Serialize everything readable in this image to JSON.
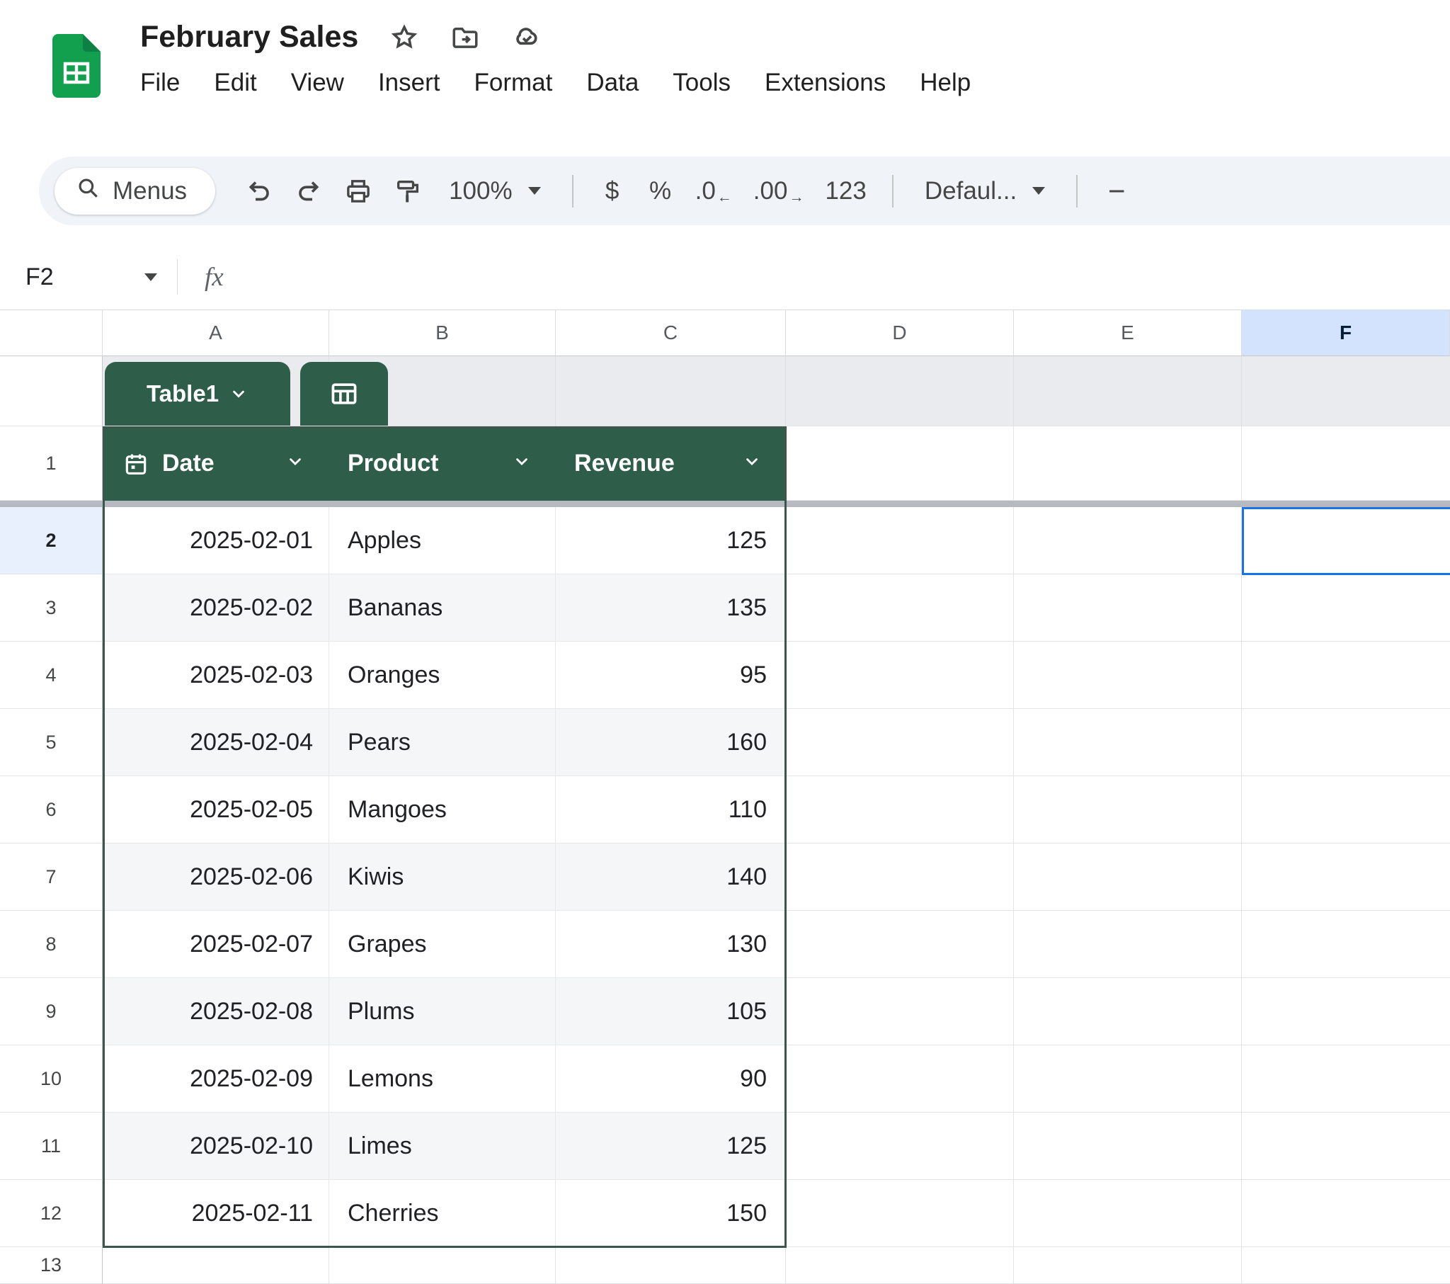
{
  "doc": {
    "title": "February Sales"
  },
  "menu": {
    "items": [
      "File",
      "Edit",
      "View",
      "Insert",
      "Format",
      "Data",
      "Tools",
      "Extensions",
      "Help"
    ]
  },
  "toolbar": {
    "menus_label": "Menus",
    "zoom": "100%",
    "currency": "$",
    "percent": "%",
    "decrease_decimal_label": ".0",
    "decrease_decimal_arrow": "←",
    "increase_decimal_label": ".00",
    "increase_decimal_arrow": "→",
    "more_formats_label": "123",
    "font_family": "Defaul...",
    "decrease_font_size": "−"
  },
  "formula_bar": {
    "cell_reference": "F2",
    "fx_label": "fx"
  },
  "grid": {
    "columns": [
      "A",
      "B",
      "C",
      "D",
      "E",
      "F"
    ],
    "row_numbers": [
      "1",
      "2",
      "3",
      "4",
      "5",
      "6",
      "7",
      "8",
      "9",
      "10",
      "11",
      "12",
      "13"
    ]
  },
  "table": {
    "name": "Table1",
    "headers": {
      "date": "Date",
      "product": "Product",
      "revenue": "Revenue"
    },
    "rows": [
      {
        "date": "2025-02-01",
        "product": "Apples",
        "revenue": "125"
      },
      {
        "date": "2025-02-02",
        "product": "Bananas",
        "revenue": "135"
      },
      {
        "date": "2025-02-03",
        "product": "Oranges",
        "revenue": "95"
      },
      {
        "date": "2025-02-04",
        "product": "Pears",
        "revenue": "160"
      },
      {
        "date": "2025-02-05",
        "product": "Mangoes",
        "revenue": "110"
      },
      {
        "date": "2025-02-06",
        "product": "Kiwis",
        "revenue": "140"
      },
      {
        "date": "2025-02-07",
        "product": "Grapes",
        "revenue": "130"
      },
      {
        "date": "2025-02-08",
        "product": "Plums",
        "revenue": "105"
      },
      {
        "date": "2025-02-09",
        "product": "Lemons",
        "revenue": "90"
      },
      {
        "date": "2025-02-10",
        "product": "Limes",
        "revenue": "125"
      },
      {
        "date": "2025-02-11",
        "product": "Cherries",
        "revenue": "150"
      }
    ]
  },
  "colors": {
    "table_green": "#2e5d49",
    "selection_blue": "#1a73e8",
    "selected_header_bg": "#d3e3fd",
    "logo_green": "#12a04f"
  }
}
